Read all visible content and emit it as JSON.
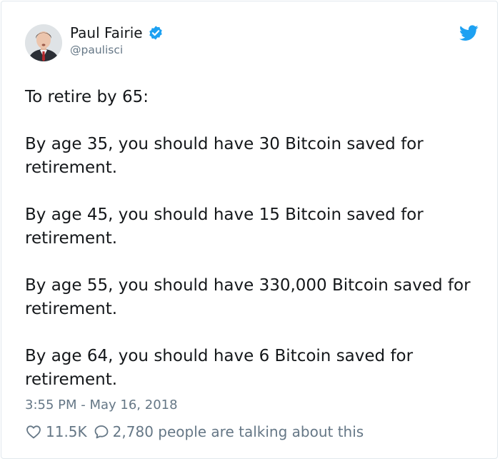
{
  "author": {
    "name": "Paul Fairie",
    "handle": "@paulisci",
    "verified": true
  },
  "icons": {
    "verified": "verified-badge-icon",
    "platform": "twitter-bird-icon",
    "like": "heart-icon",
    "reply": "speech-bubble-icon"
  },
  "colors": {
    "brand": "#1da1f2",
    "text": "#14171a",
    "muted": "#657786"
  },
  "tweet": {
    "paragraphs": [
      "To retire by 65:",
      "By age 35, you should have 30 Bitcoin saved for retirement.",
      "By age 45, you should have 15 Bitcoin saved for retirement.",
      "By age 55, you should have 330,000 Bitcoin saved for retirement.",
      "By age 64, you should have 6 Bitcoin saved for retirement."
    ],
    "timestamp": "3:55 PM - May 16, 2018"
  },
  "engagement": {
    "likes": "11.5K",
    "conversation": "2,780 people are talking about this"
  }
}
